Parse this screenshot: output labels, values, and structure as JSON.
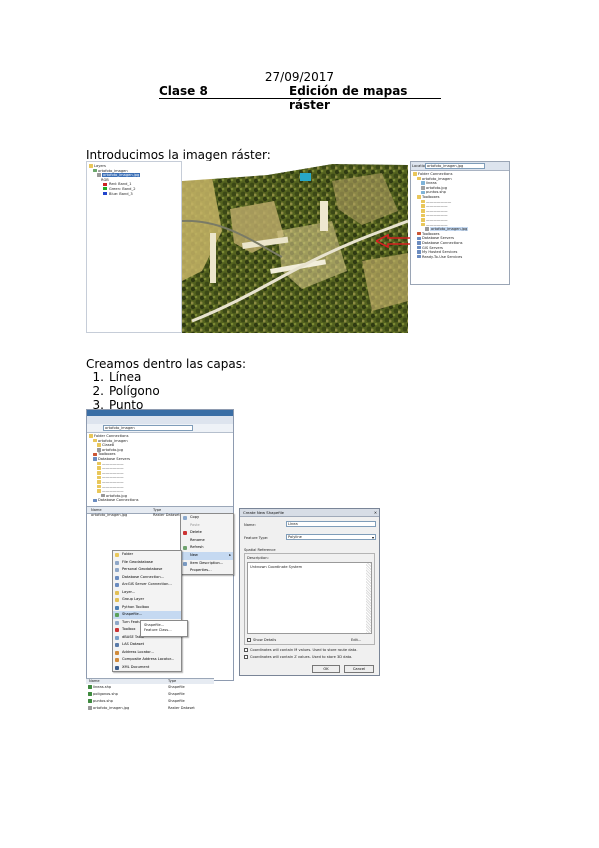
{
  "doc": {
    "date": "27/09/2017",
    "class_label": "Clase 8",
    "title": "Edición de mapas ráster",
    "intro_text": "Introducimos la imagen ráster:",
    "create_text": "Creamos dentro las capas:",
    "steps": [
      {
        "num": "1.",
        "label": "Línea"
      },
      {
        "num": "2.",
        "label": "Polígono"
      },
      {
        "num": "3.",
        "label": "Punto"
      }
    ]
  },
  "toc": {
    "items": [
      "Layers",
      "ortofoto_imagen",
      "ortofoto_imagen.jpg",
      "RGB",
      "Red: Band_1",
      "Green: Band_2",
      "Blue: Band_3"
    ],
    "band_colors": [
      "#cc2222",
      "#22aa22",
      "#2244cc"
    ]
  },
  "catalog": {
    "location_label": "Location:",
    "location_value": "ortofoto_imagen.jpg",
    "items": [
      "Folder Connections",
      "ortofoto_imagen",
      "lineas",
      "ortofoto.jpg",
      "puntos.shp",
      "Toolboxes",
      "Database Servers",
      "Database Connections",
      "GIS Servers",
      "My Hosted Services",
      "Ready-To-Use Services"
    ],
    "highlight_item": "ortofoto_imagen.jpg"
  },
  "catalog2": {
    "location_value": "ortofoto_imagen",
    "tree": [
      "Folder Connections",
      "ortofoto_imagen",
      "Clase8",
      "ortofoto.jpg",
      "Toolboxes",
      "Database Servers",
      "ortofoto.jpg",
      "Database Connections",
      "GIS Servers",
      "My Hosted Services",
      "Ready-To-Use Services"
    ],
    "col_name": "Name",
    "col_type": "Type",
    "list_name": "ortofoto_imagen.jpg",
    "list_type": "Raster Dataset",
    "menu_right": [
      "Copy",
      "Paste",
      "Delete",
      "Rename",
      "Refresh",
      "New",
      "Item Description...",
      "Properties..."
    ],
    "menu_new": [
      "Folder",
      "File Geodatabase",
      "Personal Geodatabase",
      "Database Connection...",
      "ArcGIS Server Connection...",
      "Layer...",
      "Group Layer",
      "Python Toolbox",
      "Shapefile...",
      "Turn Feature Class",
      "Toolbox",
      "dBASE Table",
      "LAS Dataset",
      "Address Locator...",
      "Composite Address Locator...",
      "XML Document"
    ],
    "menu_shape": [
      "Shapefile...",
      "Feature Class..."
    ],
    "files": [
      {
        "name": "lineas.shp",
        "type": "Shapefile"
      },
      {
        "name": "poligonos.shp",
        "type": "Shapefile"
      },
      {
        "name": "puntos.shp",
        "type": "Shapefile"
      },
      {
        "name": "ortofoto_imagen.jpg",
        "type": "Raster Dataset"
      }
    ]
  },
  "dialog": {
    "title": "Create New Shapefile",
    "name_label": "Name:",
    "name_value": "Línea",
    "feature_type_label": "Feature Type:",
    "feature_type_value": "Polyline",
    "spatial_ref_label": "Spatial Reference",
    "description_label": "Description:",
    "description_value": "Unknown Coordinate System",
    "show_details": "Show Details",
    "edit_button": "Edit...",
    "check_m": "Coordinates will contain M values. Used to store route data.",
    "check_z": "Coordinates will contain Z values. Used to store 3D data.",
    "ok": "OK",
    "cancel": "Cancel"
  },
  "colors": {
    "aerial_dark": "#3d4a1e",
    "aerial_light": "#c8b66a",
    "highlight": "#c5d9f1",
    "arrow": "#d62020"
  }
}
